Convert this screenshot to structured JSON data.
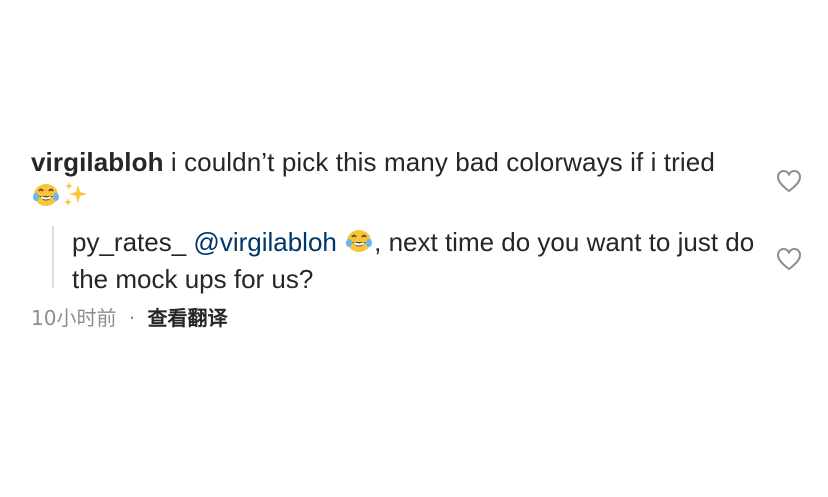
{
  "comment": {
    "username": "virgilabloh",
    "text_before_emoji": " i couldn’t pick this many bad colorways if i tried ",
    "emoji_1": "laughing-with-tears-emoji",
    "emoji_2": "sparkles-emoji"
  },
  "reply": {
    "username": "py_rates_",
    "mention": "@virgilabloh",
    "emoji": "laughing-with-tears-emoji",
    "text_after_emoji": ", next time do you want to just do the mock ups for us?"
  },
  "meta": {
    "time": "10小时前",
    "separator": "·",
    "translate_label": "查看翻译"
  },
  "colors": {
    "text": "#262626",
    "mention": "#00376b",
    "muted": "#8e8e8e",
    "thread_line": "#dbdbdb",
    "emoji_face": "#f7c43a"
  }
}
